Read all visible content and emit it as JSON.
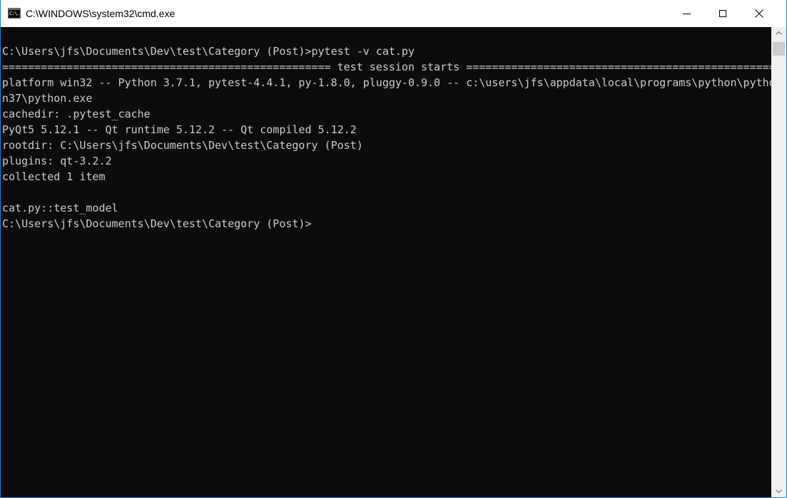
{
  "window": {
    "title": "C:\\WINDOWS\\system32\\cmd.exe",
    "icon": "cmd-console-icon",
    "icon_text": "C:\\."
  },
  "controls": {
    "minimize_icon": "minimize-icon",
    "maximize_icon": "maximize-icon",
    "close_icon": "close-icon"
  },
  "terminal": {
    "lines": [
      "C:\\Users\\jfs\\Documents\\Dev\\test\\Category (Post)>pytest -v cat.py",
      "=================================================== test session starts ===================================================",
      "platform win32 -- Python 3.7.1, pytest-4.4.1, py-1.8.0, pluggy-0.9.0 -- c:\\users\\jfs\\appdata\\local\\programs\\python\\pytho",
      "n37\\python.exe",
      "cachedir: .pytest_cache",
      "PyQt5 5.12.1 -- Qt runtime 5.12.2 -- Qt compiled 5.12.2",
      "rootdir: C:\\Users\\jfs\\Documents\\Dev\\test\\Category (Post)",
      "plugins: qt-3.2.2",
      "collected 1 item",
      "",
      "cat.py::test_model",
      "C:\\Users\\jfs\\Documents\\Dev\\test\\Category (Post)>"
    ],
    "text_color": "#cccccc",
    "background": "#0c0c0c"
  },
  "scrollbar": {
    "up_icon": "scroll-up-arrow-icon",
    "down_icon": "scroll-down-arrow-icon"
  }
}
